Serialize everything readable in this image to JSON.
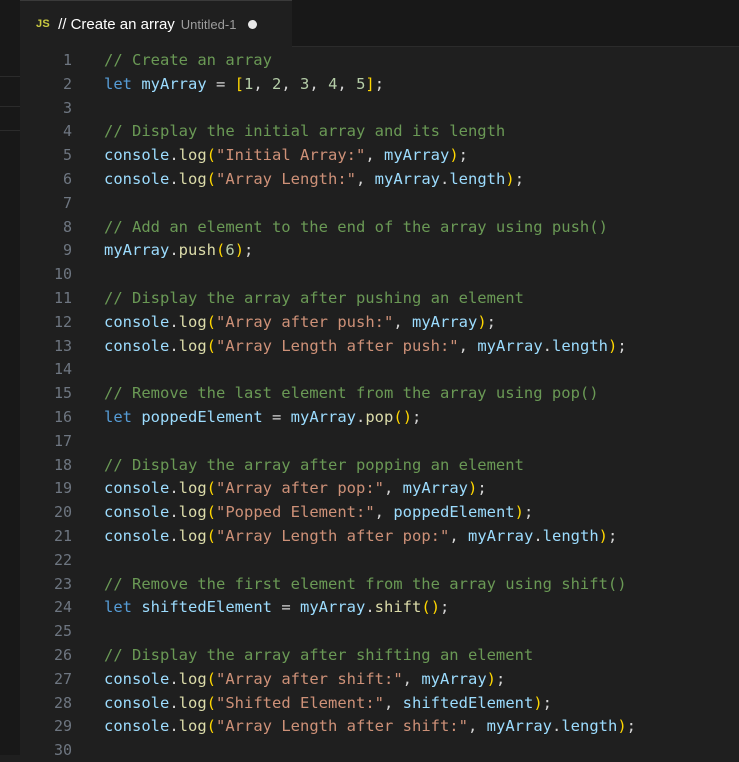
{
  "tab": {
    "icon": "JS",
    "title": "// Create an array",
    "description": "Untitled-1",
    "modified": true
  },
  "colors": {
    "background": "#1f1f1f",
    "comment": "#6a9955",
    "keyword": "#569cd6",
    "variable": "#9cdcfe",
    "number": "#b5cea8",
    "string": "#ce9178",
    "function": "#dcdcaa",
    "bracket": "#ffd700",
    "paren": "#da70d6"
  },
  "editor": {
    "lines": [
      {
        "n": "1",
        "tokens": [
          [
            "c",
            "// Create an array"
          ]
        ]
      },
      {
        "n": "2",
        "tokens": [
          [
            "k",
            "let"
          ],
          [
            "p",
            " "
          ],
          [
            "v",
            "myArray"
          ],
          [
            "p",
            " = "
          ],
          [
            "b",
            "["
          ],
          [
            "num",
            "1"
          ],
          [
            "p",
            ", "
          ],
          [
            "num",
            "2"
          ],
          [
            "p",
            ", "
          ],
          [
            "num",
            "3"
          ],
          [
            "p",
            ", "
          ],
          [
            "num",
            "4"
          ],
          [
            "p",
            ", "
          ],
          [
            "num",
            "5"
          ],
          [
            "b",
            "]"
          ],
          [
            "p",
            ";"
          ]
        ]
      },
      {
        "n": "3",
        "tokens": []
      },
      {
        "n": "4",
        "tokens": [
          [
            "c",
            "// Display the initial array and its length"
          ]
        ]
      },
      {
        "n": "5",
        "tokens": [
          [
            "v",
            "console"
          ],
          [
            "p",
            "."
          ],
          [
            "f",
            "log"
          ],
          [
            "b",
            "("
          ],
          [
            "s",
            "\"Initial Array:\""
          ],
          [
            "p",
            ", "
          ],
          [
            "v",
            "myArray"
          ],
          [
            "b",
            ")"
          ],
          [
            "p",
            ";"
          ]
        ]
      },
      {
        "n": "6",
        "tokens": [
          [
            "v",
            "console"
          ],
          [
            "p",
            "."
          ],
          [
            "f",
            "log"
          ],
          [
            "b",
            "("
          ],
          [
            "s",
            "\"Array Length:\""
          ],
          [
            "p",
            ", "
          ],
          [
            "v",
            "myArray"
          ],
          [
            "p",
            "."
          ],
          [
            "v",
            "length"
          ],
          [
            "b",
            ")"
          ],
          [
            "p",
            ";"
          ]
        ]
      },
      {
        "n": "7",
        "tokens": []
      },
      {
        "n": "8",
        "tokens": [
          [
            "c",
            "// Add an element to the end of the array using push()"
          ]
        ]
      },
      {
        "n": "9",
        "tokens": [
          [
            "v",
            "myArray"
          ],
          [
            "p",
            "."
          ],
          [
            "f",
            "push"
          ],
          [
            "b",
            "("
          ],
          [
            "num",
            "6"
          ],
          [
            "b",
            ")"
          ],
          [
            "p",
            ";"
          ]
        ]
      },
      {
        "n": "10",
        "tokens": []
      },
      {
        "n": "11",
        "tokens": [
          [
            "c",
            "// Display the array after pushing an element"
          ]
        ]
      },
      {
        "n": "12",
        "tokens": [
          [
            "v",
            "console"
          ],
          [
            "p",
            "."
          ],
          [
            "f",
            "log"
          ],
          [
            "b",
            "("
          ],
          [
            "s",
            "\"Array after push:\""
          ],
          [
            "p",
            ", "
          ],
          [
            "v",
            "myArray"
          ],
          [
            "b",
            ")"
          ],
          [
            "p",
            ";"
          ]
        ]
      },
      {
        "n": "13",
        "tokens": [
          [
            "v",
            "console"
          ],
          [
            "p",
            "."
          ],
          [
            "f",
            "log"
          ],
          [
            "b",
            "("
          ],
          [
            "s",
            "\"Array Length after push:\""
          ],
          [
            "p",
            ", "
          ],
          [
            "v",
            "myArray"
          ],
          [
            "p",
            "."
          ],
          [
            "v",
            "length"
          ],
          [
            "b",
            ")"
          ],
          [
            "p",
            ";"
          ]
        ]
      },
      {
        "n": "14",
        "tokens": []
      },
      {
        "n": "15",
        "tokens": [
          [
            "c",
            "// Remove the last element from the array using pop()"
          ]
        ]
      },
      {
        "n": "16",
        "tokens": [
          [
            "k",
            "let"
          ],
          [
            "p",
            " "
          ],
          [
            "v",
            "poppedElement"
          ],
          [
            "p",
            " = "
          ],
          [
            "v",
            "myArray"
          ],
          [
            "p",
            "."
          ],
          [
            "f",
            "pop"
          ],
          [
            "b",
            "("
          ],
          [
            "b",
            ")"
          ],
          [
            "p",
            ";"
          ]
        ]
      },
      {
        "n": "17",
        "tokens": []
      },
      {
        "n": "18",
        "tokens": [
          [
            "c",
            "// Display the array after popping an element"
          ]
        ]
      },
      {
        "n": "19",
        "tokens": [
          [
            "v",
            "console"
          ],
          [
            "p",
            "."
          ],
          [
            "f",
            "log"
          ],
          [
            "b",
            "("
          ],
          [
            "s",
            "\"Array after pop:\""
          ],
          [
            "p",
            ", "
          ],
          [
            "v",
            "myArray"
          ],
          [
            "b",
            ")"
          ],
          [
            "p",
            ";"
          ]
        ]
      },
      {
        "n": "20",
        "tokens": [
          [
            "v",
            "console"
          ],
          [
            "p",
            "."
          ],
          [
            "f",
            "log"
          ],
          [
            "b",
            "("
          ],
          [
            "s",
            "\"Popped Element:\""
          ],
          [
            "p",
            ", "
          ],
          [
            "v",
            "poppedElement"
          ],
          [
            "b",
            ")"
          ],
          [
            "p",
            ";"
          ]
        ]
      },
      {
        "n": "21",
        "tokens": [
          [
            "v",
            "console"
          ],
          [
            "p",
            "."
          ],
          [
            "f",
            "log"
          ],
          [
            "b",
            "("
          ],
          [
            "s",
            "\"Array Length after pop:\""
          ],
          [
            "p",
            ", "
          ],
          [
            "v",
            "myArray"
          ],
          [
            "p",
            "."
          ],
          [
            "v",
            "length"
          ],
          [
            "b",
            ")"
          ],
          [
            "p",
            ";"
          ]
        ]
      },
      {
        "n": "22",
        "tokens": []
      },
      {
        "n": "23",
        "tokens": [
          [
            "c",
            "// Remove the first element from the array using shift()"
          ]
        ]
      },
      {
        "n": "24",
        "tokens": [
          [
            "k",
            "let"
          ],
          [
            "p",
            " "
          ],
          [
            "v",
            "shiftedElement"
          ],
          [
            "p",
            " = "
          ],
          [
            "v",
            "myArray"
          ],
          [
            "p",
            "."
          ],
          [
            "f",
            "shift"
          ],
          [
            "b",
            "("
          ],
          [
            "b",
            ")"
          ],
          [
            "p",
            ";"
          ]
        ]
      },
      {
        "n": "25",
        "tokens": []
      },
      {
        "n": "26",
        "tokens": [
          [
            "c",
            "// Display the array after shifting an element"
          ]
        ]
      },
      {
        "n": "27",
        "tokens": [
          [
            "v",
            "console"
          ],
          [
            "p",
            "."
          ],
          [
            "f",
            "log"
          ],
          [
            "b",
            "("
          ],
          [
            "s",
            "\"Array after shift:\""
          ],
          [
            "p",
            ", "
          ],
          [
            "v",
            "myArray"
          ],
          [
            "b",
            ")"
          ],
          [
            "p",
            ";"
          ]
        ]
      },
      {
        "n": "28",
        "tokens": [
          [
            "v",
            "console"
          ],
          [
            "p",
            "."
          ],
          [
            "f",
            "log"
          ],
          [
            "b",
            "("
          ],
          [
            "s",
            "\"Shifted Element:\""
          ],
          [
            "p",
            ", "
          ],
          [
            "v",
            "shiftedElement"
          ],
          [
            "b",
            ")"
          ],
          [
            "p",
            ";"
          ]
        ]
      },
      {
        "n": "29",
        "tokens": [
          [
            "v",
            "console"
          ],
          [
            "p",
            "."
          ],
          [
            "f",
            "log"
          ],
          [
            "b",
            "("
          ],
          [
            "s",
            "\"Array Length after shift:\""
          ],
          [
            "p",
            ", "
          ],
          [
            "v",
            "myArray"
          ],
          [
            "p",
            "."
          ],
          [
            "v",
            "length"
          ],
          [
            "b",
            ")"
          ],
          [
            "p",
            ";"
          ]
        ]
      },
      {
        "n": "30",
        "tokens": []
      }
    ]
  }
}
